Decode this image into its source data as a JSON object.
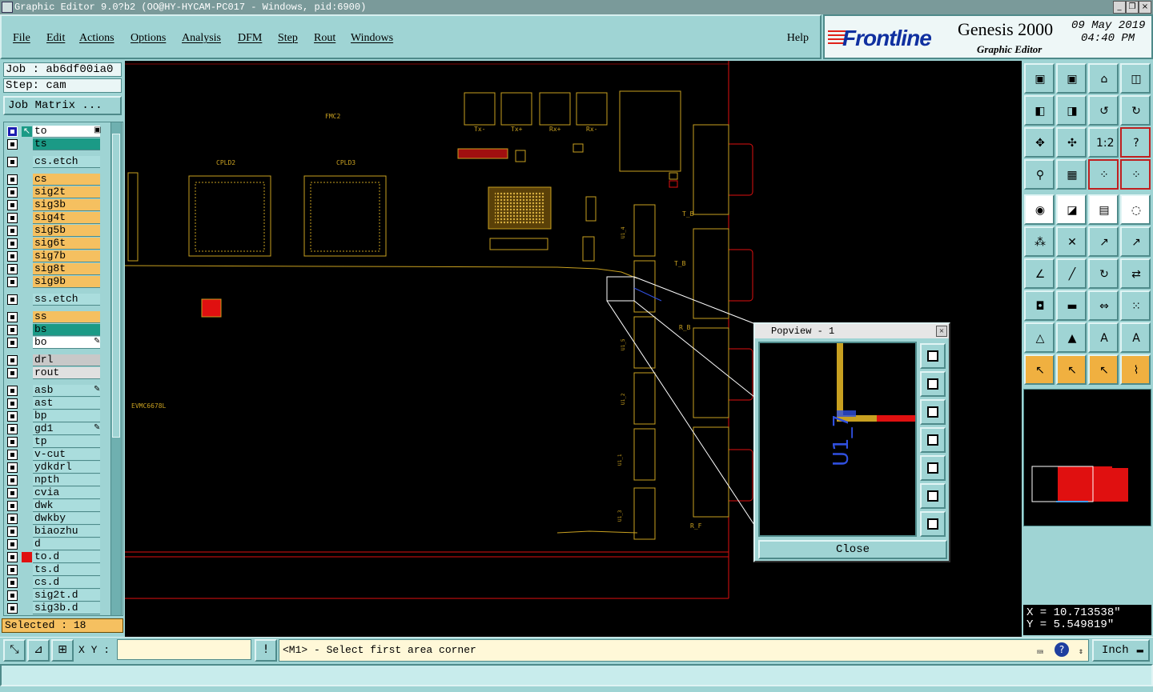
{
  "window": {
    "title": "Graphic Editor 9.0?b2 (OO@HY-HYCAM-PC017 - Windows, pid:6900)",
    "controls": [
      "_",
      "❐",
      "×"
    ]
  },
  "menu": {
    "items": [
      "File",
      "Edit",
      "Actions",
      "Options",
      "Analysis",
      "DFM",
      "Step",
      "Rout",
      "Windows"
    ],
    "help": "Help"
  },
  "brand": {
    "logo": "Frontline",
    "product": "Genesis 2000",
    "subtitle": "Graphic Editor",
    "date": "09 May 2019",
    "time": "04:40 PM"
  },
  "job": {
    "job_label": "Job : ab6df00ia0",
    "step_label": "Step: cam",
    "matrix_button": "Job Matrix ..."
  },
  "layers": [
    {
      "name": "to",
      "color": "#ffffff",
      "active": true,
      "flag": "▣"
    },
    {
      "name": "ts",
      "color": "#1b9a86",
      "active": false,
      "flag": ""
    },
    {
      "name": "cs.etch",
      "color": "#aadddd",
      "active": false,
      "flag": ""
    },
    {
      "name": "cs",
      "color": "#f5c060",
      "active": false,
      "flag": ""
    },
    {
      "name": "sig2t",
      "color": "#f5c060",
      "active": false,
      "flag": ""
    },
    {
      "name": "sig3b",
      "color": "#f5c060",
      "active": false,
      "flag": ""
    },
    {
      "name": "sig4t",
      "color": "#f5c060",
      "active": false,
      "flag": ""
    },
    {
      "name": "sig5b",
      "color": "#f5c060",
      "active": false,
      "flag": ""
    },
    {
      "name": "sig6t",
      "color": "#f5c060",
      "active": false,
      "flag": ""
    },
    {
      "name": "sig7b",
      "color": "#f5c060",
      "active": false,
      "flag": ""
    },
    {
      "name": "sig8t",
      "color": "#f5c060",
      "active": false,
      "flag": ""
    },
    {
      "name": "sig9b",
      "color": "#f5c060",
      "active": false,
      "flag": ""
    },
    {
      "name": "ss.etch",
      "color": "#aadddd",
      "active": false,
      "flag": ""
    },
    {
      "name": "ss",
      "color": "#f5c060",
      "active": false,
      "flag": ""
    },
    {
      "name": "bs",
      "color": "#1b9a86",
      "active": false,
      "flag": ""
    },
    {
      "name": "bo",
      "color": "#ffffff",
      "active": false,
      "flag": "✎"
    },
    {
      "name": "drl",
      "color": "#c8c8c8",
      "active": false,
      "flag": ""
    },
    {
      "name": "rout",
      "color": "#e0e0e0",
      "active": false,
      "flag": ""
    },
    {
      "name": "asb",
      "color": "#aadddd",
      "active": false,
      "flag": "✎"
    },
    {
      "name": "ast",
      "color": "#aadddd",
      "active": false,
      "flag": ""
    },
    {
      "name": "bp",
      "color": "#aadddd",
      "active": false,
      "flag": ""
    },
    {
      "name": "gd1",
      "color": "#aadddd",
      "active": false,
      "flag": "✎"
    },
    {
      "name": "tp",
      "color": "#aadddd",
      "active": false,
      "flag": ""
    },
    {
      "name": "v-cut",
      "color": "#aadddd",
      "active": false,
      "flag": ""
    },
    {
      "name": "ydkdrl",
      "color": "#aadddd",
      "active": false,
      "flag": ""
    },
    {
      "name": "npth",
      "color": "#aadddd",
      "active": false,
      "flag": ""
    },
    {
      "name": "cvia",
      "color": "#aadddd",
      "active": false,
      "flag": ""
    },
    {
      "name": "dwk",
      "color": "#aadddd",
      "active": false,
      "flag": ""
    },
    {
      "name": "dwkby",
      "color": "#aadddd",
      "active": false,
      "flag": ""
    },
    {
      "name": "biaozhu",
      "color": "#aadddd",
      "active": false,
      "flag": ""
    },
    {
      "name": "d",
      "color": "#aadddd",
      "active": false,
      "flag": ""
    },
    {
      "name": "to.d",
      "color": "#aadddd",
      "active": false,
      "flag": "",
      "mark": "#e01010"
    },
    {
      "name": "ts.d",
      "color": "#aadddd",
      "active": false,
      "flag": ""
    },
    {
      "name": "cs.d",
      "color": "#aadddd",
      "active": false,
      "flag": ""
    },
    {
      "name": "sig2t.d",
      "color": "#aadddd",
      "active": false,
      "flag": ""
    },
    {
      "name": "sig3b.d",
      "color": "#aadddd",
      "active": false,
      "flag": ""
    }
  ],
  "selected": "Selected : 18",
  "board_labels": {
    "fmc": "FMC2",
    "cpld2": "CPLD2",
    "cpld3": "CPLD3",
    "evm": "EVMC6678L",
    "conn_tx_minus": "Tx-",
    "conn_tx_plus": "Tx+",
    "conn_rx_plus": "Rx+",
    "conn_rx_minus": "Rx-",
    "tb1": "T_B",
    "tb2": "T_B",
    "rb": "R_B",
    "rf": "R_F",
    "u14": "U1_4",
    "u15": "U1_5",
    "u12": "U1_2",
    "u11": "U1_1",
    "u13": "U1_3"
  },
  "popview": {
    "title": "Popview - 1",
    "close_button": "Close",
    "label": "U1_7"
  },
  "coordinates": {
    "x": "X = 10.713538\"",
    "y": "Y = 5.549819\""
  },
  "bottom": {
    "xy_label": "X Y :",
    "xy_value": "",
    "message": "<M1> - Select first area corner",
    "unit": "Inch",
    "warn_button": "!"
  },
  "colors": {
    "panel": "#9fd4d4",
    "trace": "#c8a020",
    "outline": "#e01010",
    "active_layer": "#1c1cb0"
  }
}
